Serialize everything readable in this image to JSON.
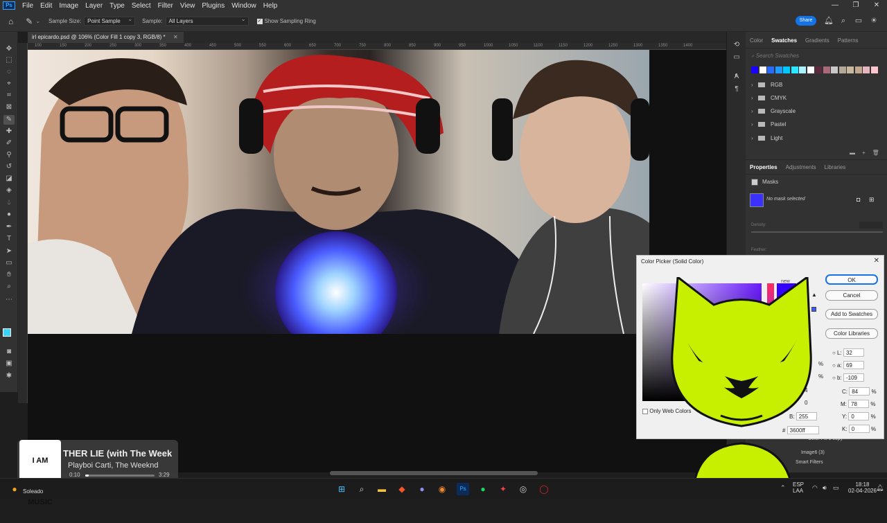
{
  "menubar": {
    "logo": "Ps",
    "items": [
      "File",
      "Edit",
      "Image",
      "Layer",
      "Type",
      "Select",
      "Filter",
      "View",
      "Plugins",
      "Help",
      "Window",
      "Help"
    ],
    "window_controls": [
      "—",
      "❐",
      "✕"
    ]
  },
  "options": {
    "sample_size_label": "Sample Size:",
    "sample_size_value": "Point Sample",
    "sample_label": "Sample:",
    "sample_value": "All Layers",
    "sampling_ring_label": "Show Sampling Ring",
    "share": "Share"
  },
  "document": {
    "tab_title": "irl epicardo.psd @ 106% (Color Fill 1 copy 3, RGB/8) *",
    "ruler_ticks": [
      "100",
      "150",
      "200",
      "250",
      "300",
      "350",
      "400",
      "450",
      "500",
      "550",
      "600",
      "650",
      "700",
      "750",
      "800",
      "850",
      "900",
      "950",
      "1000",
      "1050",
      "1100",
      "1150",
      "1200",
      "1250",
      "1300",
      "1350",
      "1400"
    ]
  },
  "swatches_panel": {
    "tabs": [
      "Color",
      "Swatches",
      "Gradients",
      "Patterns"
    ],
    "active": "Swatches",
    "search_placeholder": "Search Swatches",
    "colors": [
      "#1a00ff",
      "#ffffff",
      "#2a6bff",
      "#1d9bff",
      "#00c8ff",
      "#2de6ff",
      "#aaf2ff",
      "#ffffff",
      "#5b2a3c",
      "#a86a78",
      "#c8c8c8",
      "#b6a898",
      "#c8b8a0",
      "#c0a890",
      "#e6b7c0",
      "#ffc6d0"
    ],
    "folders": [
      "RGB",
      "CMYK",
      "Grayscale",
      "Pastel",
      "Light"
    ]
  },
  "properties_panel": {
    "tabs": [
      "Properties",
      "Adjustments",
      "Libraries"
    ],
    "active": "Properties",
    "masks_label": "Masks",
    "mask_status": "No mask selected",
    "density_label": "Density:",
    "feather_label": "Feather:"
  },
  "color_picker": {
    "title": "Color Picker (Solid Color)",
    "ok": "OK",
    "cancel": "Cancel",
    "add_to_swatches": "Add to Swatches",
    "color_libraries": "Color Libraries",
    "only_web_colors": "Only Web Colors",
    "new_label": "new",
    "L": "32",
    "a": "69",
    "b_lab": "-109",
    "C": "84",
    "M": "78",
    "Y": "0",
    "K": "0",
    "G": "0",
    "B": "255",
    "hex": "3600ff",
    "h_partial": "8",
    "s_partial": "%",
    "r_partial": "4",
    "pct": "%"
  },
  "media": {
    "album_text": "I AM MUSIC",
    "title": "THER LIE (with The Week",
    "artist": "Playboi Carti, The Weeknd",
    "elapsed": "0:10",
    "total": "3:29",
    "progress": 0.05
  },
  "weather": {
    "label": "Soleado"
  },
  "layers_peek": {
    "row1": "Color Fill 1 copy",
    "row2": "Image6 (3)",
    "row3": "Smart Filters"
  },
  "taskbar": {
    "lang": "ESP",
    "lang2": "LAA",
    "time": "18:18",
    "date": "02-04-2026"
  }
}
